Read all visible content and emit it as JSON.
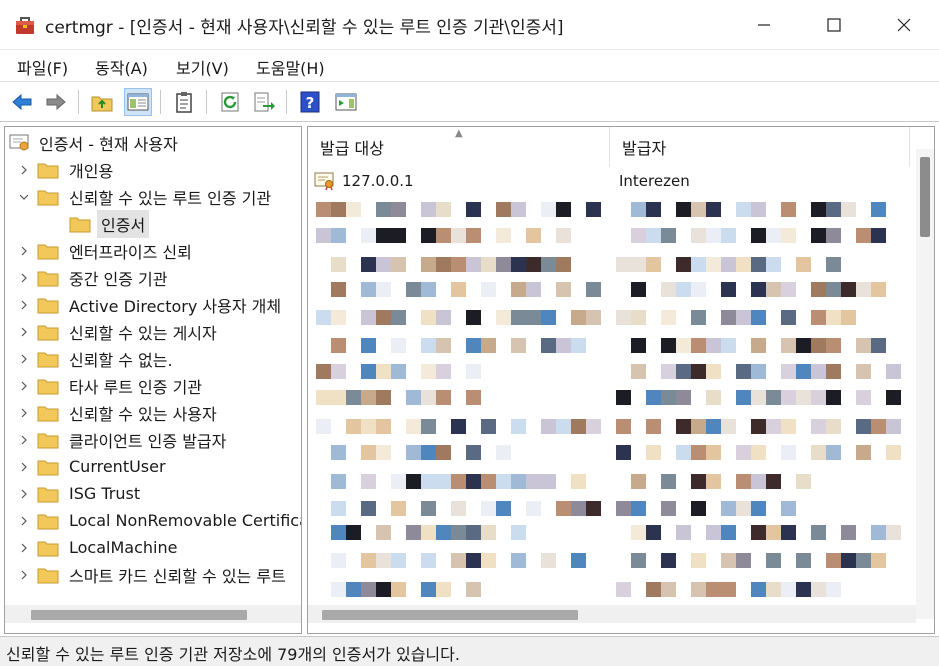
{
  "window": {
    "title": "certmgr - [인증서 - 현재 사용자\\신뢰할 수 있는 루트 인증 기관\\인증서]"
  },
  "menu": [
    {
      "label": "파일(F)"
    },
    {
      "label": "동작(A)"
    },
    {
      "label": "보기(V)"
    },
    {
      "label": "도움말(H)"
    }
  ],
  "toolbar": {
    "icons": [
      "back-arrow-icon",
      "forward-arrow-icon",
      "up-folder-icon",
      "show-tree-icon",
      "clipboard-icon",
      "refresh-icon",
      "export-list-icon",
      "help-icon",
      "action-pane-icon"
    ]
  },
  "tree": {
    "root": "인증서 - 현재 사용자",
    "items": [
      {
        "label": "개인용"
      },
      {
        "label": "신뢰할 수 있는 루트 인증 기관"
      },
      {
        "label": "인증서"
      },
      {
        "label": "엔터프라이즈 신뢰"
      },
      {
        "label": "중간 인증 기관"
      },
      {
        "label": "Active Directory 사용자 개체"
      },
      {
        "label": "신뢰할 수 있는 게시자"
      },
      {
        "label": "신뢰할 수 없는."
      },
      {
        "label": "타사 루트 인증 기관"
      },
      {
        "label": "신뢰할 수 있는 사용자"
      },
      {
        "label": "클라이언트 인증 발급자"
      },
      {
        "label": "CurrentUser"
      },
      {
        "label": "ISG Trust"
      },
      {
        "label": "Local NonRemovable Certificates"
      },
      {
        "label": "LocalMachine"
      },
      {
        "label": "스마트 카드 신뢰할 수 있는 루트"
      }
    ]
  },
  "list": {
    "columns": [
      "발급 대상",
      "발급자"
    ],
    "first_row": {
      "issued_to": "127.0.0.1",
      "issued_by": "Interezen"
    }
  },
  "status": {
    "text": "신뢰할 수 있는 루트 인증 기관 저장소에 79개의 인증서가 있습니다."
  },
  "colors": {
    "folder": "#f3c85a",
    "accent": "#1f6fd1",
    "selection": "#e3e3e3"
  }
}
